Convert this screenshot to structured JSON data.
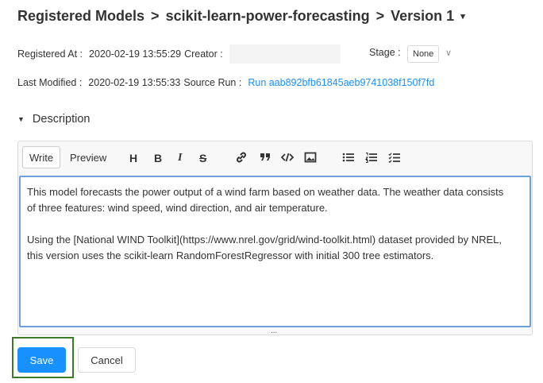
{
  "breadcrumb": {
    "root": "Registered Models",
    "separator": ">",
    "model": "scikit-learn-power-forecasting",
    "version": "Version 1",
    "caret": "▾"
  },
  "meta": {
    "registered_at_label": "Registered At :",
    "registered_at_value": "2020-02-19 13:55:29",
    "creator_label": "Creator :",
    "creator_value": "",
    "stage_label": "Stage :",
    "stage_value": "None",
    "stage_chevron": "∨",
    "last_modified_label": "Last Modified :",
    "last_modified_value": "2020-02-19 13:55:33",
    "source_run_label": "Source Run :",
    "source_run_value": "Run aab892bfb61845aeb9741038f150f7fd"
  },
  "description": {
    "toggle_icon": "▼",
    "label": "Description"
  },
  "editor": {
    "tabs": {
      "write": "Write",
      "preview": "Preview"
    },
    "tools": {
      "heading": "H",
      "bold": "B",
      "italic": "I",
      "strikethrough": "S",
      "link": "🔗",
      "quote": "❞",
      "code": "</>",
      "image": "▣",
      "unordered_list": "☰",
      "ordered_list": "☰",
      "checklist": "☑"
    },
    "text_lines": [
      "This model forecasts the power output of a wind farm based on weather data. The weather data consists",
      "of three features: wind speed, wind direction, and air temperature.",
      "",
      "Using the [National WIND Toolkit](https://www.nrel.gov/grid/wind-toolkit.html) dataset provided by NREL,",
      "this version uses the scikit-learn RandomForestRegressor with initial 300 tree estimators."
    ],
    "resize_handle": "..."
  },
  "actions": {
    "save": "Save",
    "cancel": "Cancel"
  },
  "colors": {
    "primary": "#1890ff",
    "link": "#1890ff",
    "textarea_focus_border": "#6fa0dc",
    "highlight_border": "#3e7b27"
  }
}
